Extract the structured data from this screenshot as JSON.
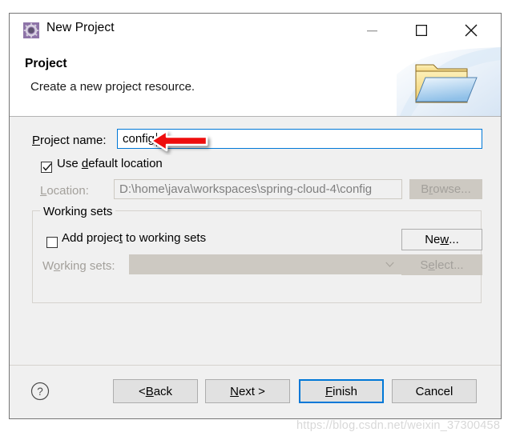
{
  "window": {
    "title": "New Project",
    "icon": "project-gear-icon",
    "controls": {
      "minimize": "minimize-icon",
      "maximize": "maximize-icon",
      "close": "close-icon"
    }
  },
  "header": {
    "title": "Project",
    "subtitle": "Create a new project resource.",
    "art_icon": "folder-icon"
  },
  "form": {
    "project_name": {
      "label_pre": "",
      "label": "Project name:",
      "label_accel": "P",
      "label_rest": "roject name:",
      "value": "config",
      "placeholder": ""
    },
    "use_default_location": {
      "label_pre": "Use ",
      "label_accel": "d",
      "label_rest": "efault location",
      "checked": true
    },
    "location": {
      "label_accel": "L",
      "label_rest": "ocation:",
      "value": "D:\\home\\java\\workspaces\\spring-cloud-4\\config",
      "enabled": false
    },
    "browse_button": {
      "label_pre": "B",
      "label_accel": "r",
      "label_rest": "owse...",
      "enabled": false
    }
  },
  "working_sets_group": {
    "title": "Working sets",
    "add_project": {
      "label_pre": "Add projec",
      "label_accel": "t",
      "label_rest": " to working sets",
      "checked": false
    },
    "working_sets_combo": {
      "label_pre": "W",
      "label_accel": "o",
      "label_rest": "rking sets:",
      "value": "",
      "enabled": false,
      "chevron": "chevron-down-icon"
    },
    "new_button": {
      "label_pre": "Ne",
      "label_accel": "w",
      "label_rest": "...",
      "enabled": true
    },
    "select_button": {
      "label_pre": "S",
      "label_accel": "e",
      "label_rest": "lect...",
      "enabled": false
    }
  },
  "footer": {
    "help_icon": "help-icon",
    "back_button": {
      "label_pre": "< ",
      "label_accel": "B",
      "label_rest": "ack"
    },
    "next_button": {
      "label_pre": "",
      "label_accel": "N",
      "label_rest": "ext >"
    },
    "finish_button": {
      "label_pre": "",
      "label_accel": "F",
      "label_rest": "inish",
      "default": true
    },
    "cancel_button": {
      "label_pre": "Cancel",
      "label_accel": "",
      "label_rest": ""
    }
  },
  "annotation": {
    "arrow": "red-left-arrow-annotation",
    "color": "#ee1111"
  },
  "watermark": {
    "text": "https://blog.csdn.net/weixin_37300458"
  },
  "colors": {
    "accent": "#0078d7",
    "dialog_bg": "#f0f0f0",
    "header_bg": "#ffffff",
    "disabled_text": "#a3a09b",
    "annotation_red": "#ee1111"
  }
}
